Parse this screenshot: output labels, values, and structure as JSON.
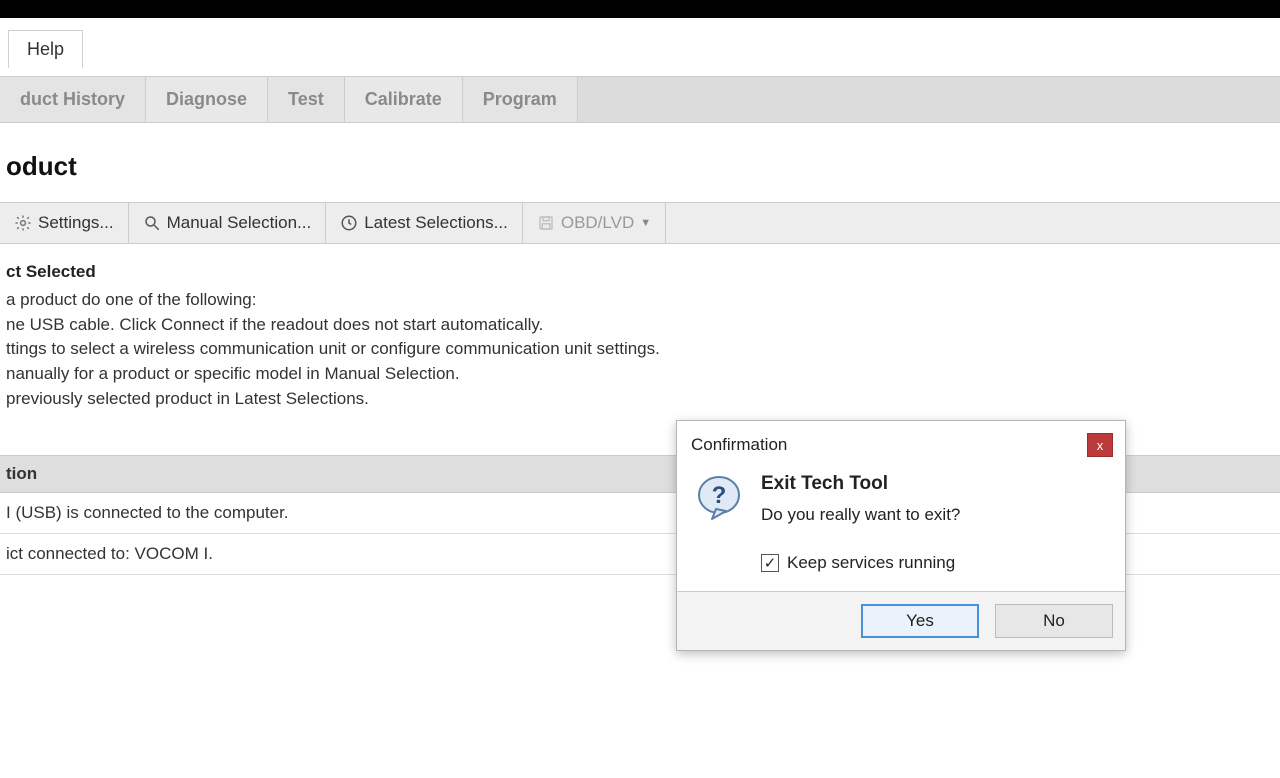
{
  "menu": {
    "help": "Help"
  },
  "tabs": {
    "product_history": "duct History",
    "diagnose": "Diagnose",
    "test": "Test",
    "calibrate": "Calibrate",
    "program": "Program"
  },
  "page_title": "oduct",
  "toolbar": {
    "settings": "Settings...",
    "manual_selection": "Manual Selection...",
    "latest_selections": "Latest Selections...",
    "obd_lvd": "OBD/LVD"
  },
  "section": {
    "heading": "ct Selected",
    "line1": "a product do one of the following:",
    "line2": "ne USB cable. Click Connect if the readout does not start automatically.",
    "line3": "ttings to select a wireless communication unit or configure communication unit settings.",
    "line4": "nanually for a product or specific model in Manual Selection.",
    "line5": " previously selected product in Latest Selections."
  },
  "status": {
    "header": "tion",
    "row1": "I (USB) is connected to the computer.",
    "row2": "ict connected to: VOCOM I."
  },
  "dialog": {
    "title": "Confirmation",
    "heading": "Exit Tech Tool",
    "message": "Do you really want to exit?",
    "checkbox_label": "Keep services running",
    "checkbox_checked": true,
    "yes": "Yes",
    "no": "No",
    "close_symbol": "x",
    "check_symbol": "✓"
  }
}
